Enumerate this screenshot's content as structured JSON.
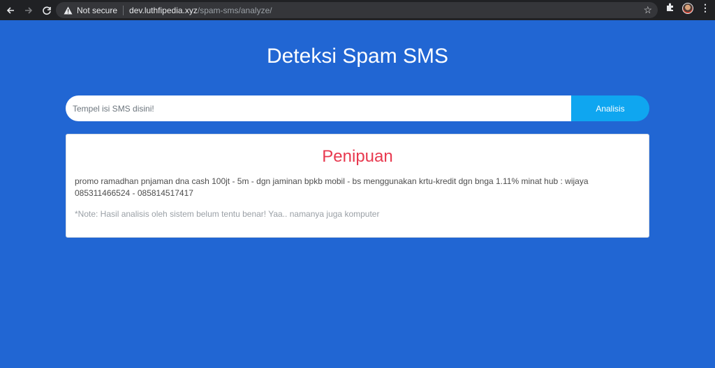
{
  "browser": {
    "security_label": "Not secure",
    "url_host": "dev.luthfipedia.xyz",
    "url_path": "/spam-sms/analyze/",
    "icons": [
      "back-icon",
      "forward-icon",
      "reload-icon",
      "warning-icon",
      "star-icon",
      "extensions-icon",
      "profile-avatar",
      "menu-icon"
    ]
  },
  "page": {
    "title": "Deteksi Spam SMS",
    "search": {
      "placeholder": "Tempel isi SMS disini!",
      "value": ""
    },
    "analyze_button": "Analisis",
    "result": {
      "label": "Penipuan",
      "label_color": "#e8394f",
      "sms": "promo ramadhan pnjaman dna cash 100jt - 5m - dgn jaminan bpkb mobil - bs menggunakan krtu-kredit dgn bnga 1.11% minat hub : wijaya 085311466524 - 085814517417",
      "note": "*Note: Hasil analisis oleh sistem belum tentu benar! Yaa.. namanya juga komputer"
    }
  },
  "colors": {
    "background": "#2166d3",
    "accent_button": "#0fa6f0"
  }
}
